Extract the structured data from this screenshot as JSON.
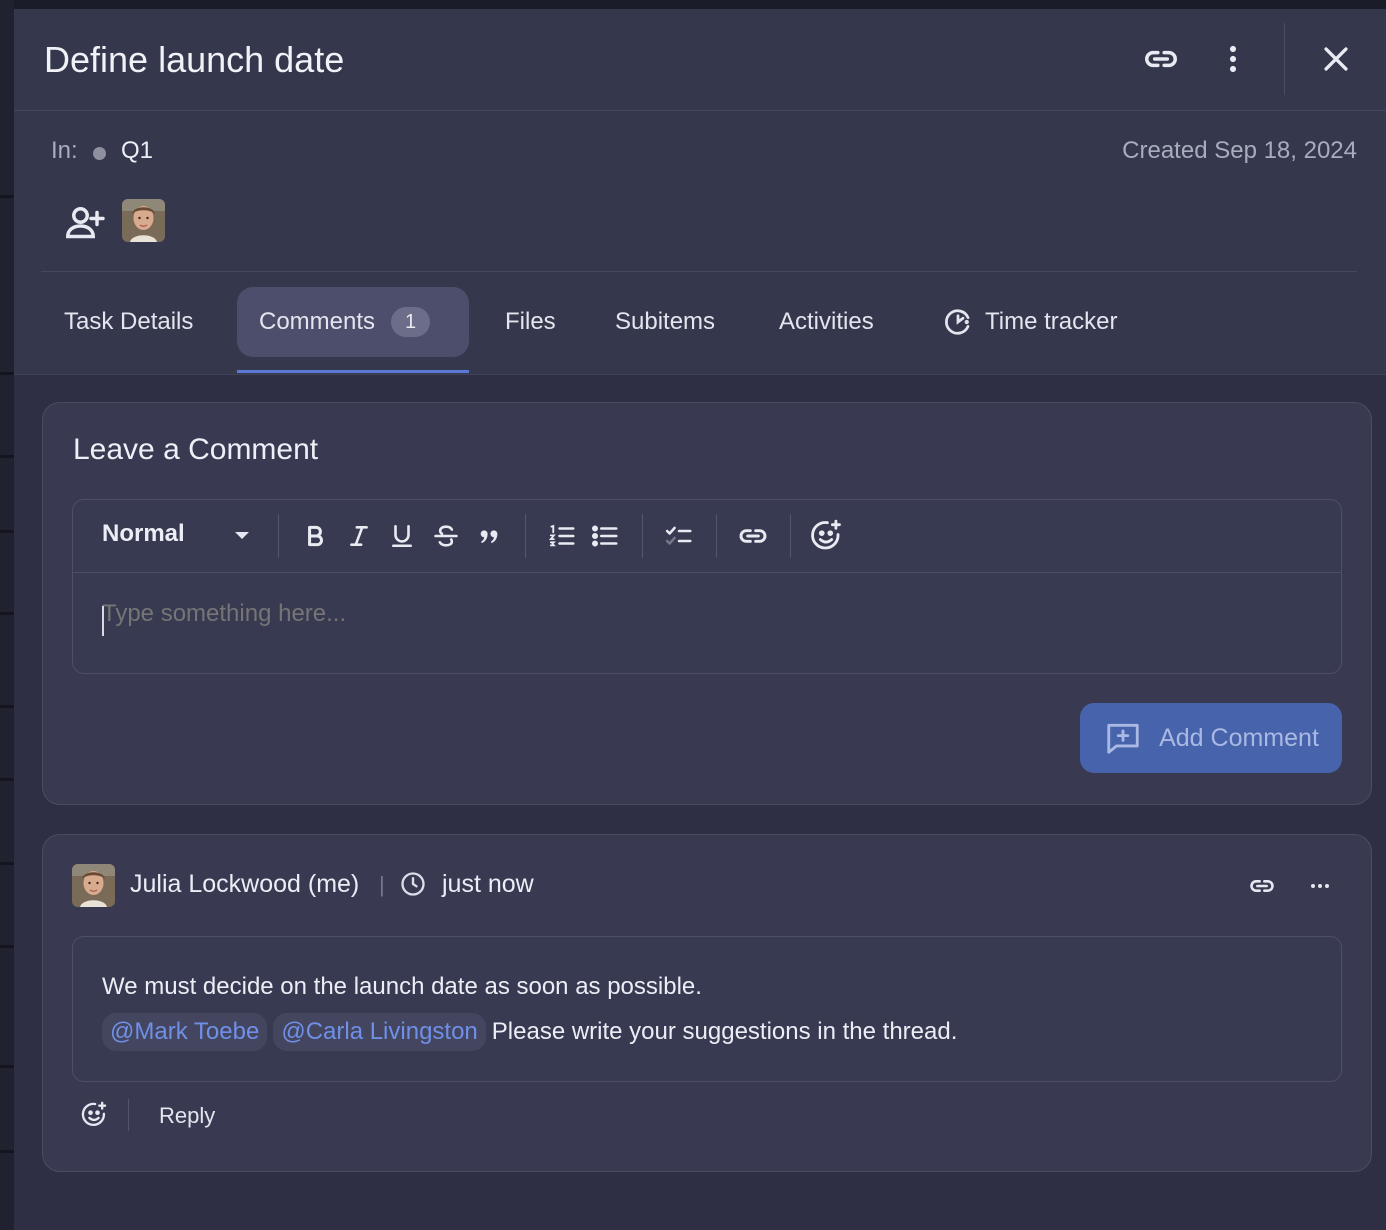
{
  "window": {
    "title": "Define launch date",
    "header_icons": [
      "link-icon",
      "more-vertical-icon",
      "close-icon"
    ]
  },
  "meta": {
    "in_label": "In:",
    "in_value": "Q1",
    "created": "Created Sep 18, 2024"
  },
  "tabs": [
    {
      "label": "Task Details"
    },
    {
      "label": "Comments",
      "badge": "1",
      "active": true
    },
    {
      "label": "Files"
    },
    {
      "label": "Subitems"
    },
    {
      "label": "Activities"
    },
    {
      "label": "Time tracker",
      "icon": "time-tracker-icon"
    }
  ],
  "composer": {
    "title": "Leave a Comment",
    "format_select": "Normal",
    "toolbar_icons": [
      "bold-icon",
      "italic-icon",
      "underline-icon",
      "strikethrough-icon",
      "quote-icon",
      "ordered-list-icon",
      "bullet-list-icon",
      "checklist-icon",
      "link-icon",
      "emoji-add-icon"
    ],
    "placeholder": "Type something here...",
    "submit_label": "Add Comment"
  },
  "comment": {
    "author": "Julia Lockwood (me)",
    "separator": "|",
    "time": "just now",
    "text_line1": "We must decide on the launch date as soon as possible.",
    "mentions": [
      "@Mark Toebe",
      "@Carla Livingston"
    ],
    "text_line2": "Please write your suggestions in the thread.",
    "reply_label": "Reply"
  },
  "colors": {
    "accent": "#5a79d6",
    "mention": "#6f8fe8",
    "button": "#4763ac",
    "panel": "#35374d"
  }
}
